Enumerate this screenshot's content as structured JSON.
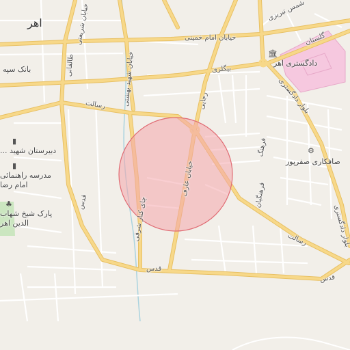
{
  "map": {
    "city": "اهر",
    "streets": {
      "imam_khomeini": "خیابان امام خمینی",
      "beygari": "بیگلری",
      "resalat_w": "رسالت",
      "resalat_e": "رسالت",
      "dadgostari_blvd": "بلوار دادگستری",
      "dadgostari_blvd_s": "بلوار دادگستری",
      "golestan": "گلستان",
      "shams_tabrizi": "شمس تبریزی",
      "taleghani": "طالقانی",
      "shahid_beheshti": "خیابان شهید بهشتی",
      "sharbiat": "خیابان شریعتی",
      "farhang": "فرهنگ",
      "farhangian": "فرهنگیان",
      "ragaei": "رجایی",
      "aref": "خیابان عارف",
      "chay_khaneh": "چای کنار شرقی",
      "qods_w": "قدس",
      "qods_e": "قدس",
      "qods_s": "قدس"
    },
    "pois": {
      "dadgostari": "دادگستری اهر",
      "bank": "بانک سپه",
      "school1": "دبیرستان شهید ...",
      "school2": "مدرسه راهنمائی",
      "school2b": "امام رضا",
      "park": "پارک شیخ شهاب",
      "park2": "الدین اهر",
      "carwash": "صافکاری صفرپور"
    },
    "colors": {
      "background": "#f2efe9",
      "road_major": "#f7d889",
      "road_major_casing": "#e8c063",
      "road_minor": "#ffffff",
      "road_minor_casing": "#d8d2c8",
      "hospital": "#f6c8df",
      "park": "#cbe6c0",
      "highlight_fill": "#f4a6ab",
      "highlight_stroke": "#e06a72",
      "river": "#aad3df"
    },
    "icons": [
      "museum-icon",
      "school-icon",
      "park-icon",
      "carwash-icon",
      "station-marker-icon"
    ]
  }
}
